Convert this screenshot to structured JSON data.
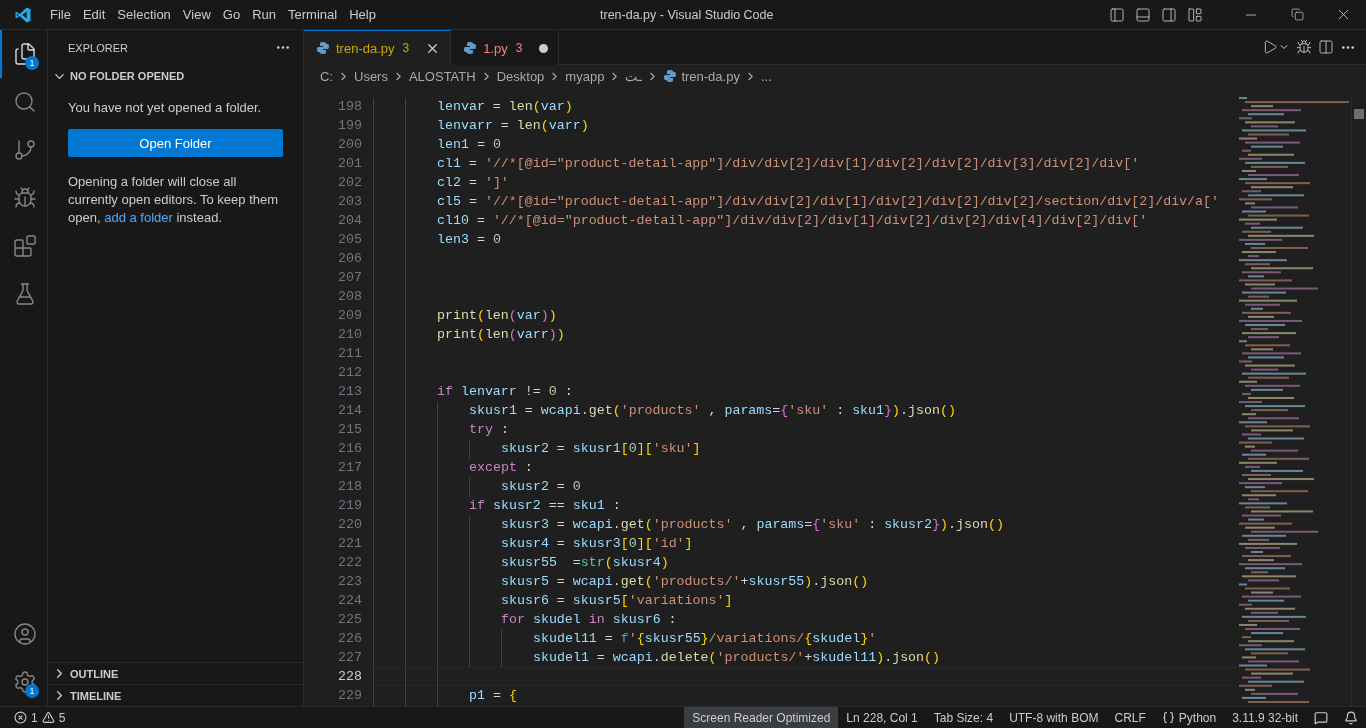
{
  "window": {
    "title": "tren-da.py - Visual Studio Code"
  },
  "menu": [
    "File",
    "Edit",
    "Selection",
    "View",
    "Go",
    "Run",
    "Terminal",
    "Help"
  ],
  "activity_bar": {
    "top": [
      {
        "kind": "files",
        "selected": true,
        "badge": "1"
      },
      {
        "kind": "search",
        "selected": false
      },
      {
        "kind": "source-control",
        "selected": false
      },
      {
        "kind": "debug",
        "selected": false
      },
      {
        "kind": "extensions",
        "selected": false
      },
      {
        "kind": "testing",
        "selected": false
      }
    ],
    "bottom": [
      {
        "kind": "account",
        "selected": false
      },
      {
        "kind": "settings",
        "selected": false,
        "badge": "1"
      }
    ]
  },
  "sidebar": {
    "title": "EXPLORER",
    "section": {
      "title": "NO FOLDER OPENED",
      "expanded": true
    },
    "message": "You have not yet opened a folder.",
    "button": "Open Folder",
    "note": {
      "before": "Opening a folder will close all currently open editors. To keep them open,",
      "link": "add a folder",
      "after": "instead."
    },
    "panels": [
      {
        "title": "OUTLINE",
        "expanded": false
      },
      {
        "title": "TIMELINE",
        "expanded": false
      }
    ]
  },
  "tabs": [
    {
      "label": "tren-da.py",
      "problems": "3",
      "selected": true,
      "dirty": false,
      "color": "#cca700"
    },
    {
      "label": "1.py",
      "problems": "3",
      "selected": false,
      "dirty": true,
      "color": "#f48771"
    }
  ],
  "breadcrumbs": {
    "parts": [
      "C:",
      "Users",
      "ALOSTATH",
      "Desktop",
      "myapp",
      "ـت"
    ],
    "file": "tren-da.py",
    "more": "..."
  },
  "code": [
    {
      "n": "198",
      "current": false,
      "tokens": [
        {
          "kind": "v",
          "text": "lenvar"
        },
        {
          "kind": "o",
          "text": " = "
        },
        {
          "kind": "f",
          "text": "len"
        },
        {
          "kind": "b1",
          "text": "("
        },
        {
          "kind": "v",
          "text": "var"
        },
        {
          "kind": "b1",
          "text": ")"
        }
      ]
    },
    {
      "n": "199",
      "current": false,
      "tokens": [
        {
          "kind": "v",
          "text": "lenvarr"
        },
        {
          "kind": "o",
          "text": " = "
        },
        {
          "kind": "f",
          "text": "len"
        },
        {
          "kind": "b1",
          "text": "("
        },
        {
          "kind": "v",
          "text": "varr"
        },
        {
          "kind": "b1",
          "text": ")"
        }
      ]
    },
    {
      "n": "200",
      "current": false,
      "tokens": [
        {
          "kind": "v",
          "text": "len1"
        },
        {
          "kind": "o",
          "text": " = "
        },
        {
          "kind": "n",
          "text": "0"
        }
      ]
    },
    {
      "n": "201",
      "current": false,
      "tokens": [
        {
          "kind": "v",
          "text": "cl1"
        },
        {
          "kind": "o",
          "text": " = "
        },
        {
          "kind": "s",
          "text": "'//*[@id=\"product-detail-app\"]/div/div[2]/div[1]/div[2]/div[2]/div[3]/div[2]/div['"
        }
      ]
    },
    {
      "n": "202",
      "current": false,
      "tokens": [
        {
          "kind": "v",
          "text": "cl2"
        },
        {
          "kind": "o",
          "text": " = "
        },
        {
          "kind": "s",
          "text": "']'"
        }
      ]
    },
    {
      "n": "203",
      "current": false,
      "tokens": [
        {
          "kind": "v",
          "text": "cl5"
        },
        {
          "kind": "o",
          "text": " = "
        },
        {
          "kind": "s",
          "text": "'//*[@id=\"product-detail-app\"]/div/div[2]/div[1]/div[2]/div[2]/div[2]/section/div[2]/div/a['"
        }
      ]
    },
    {
      "n": "204",
      "current": false,
      "tokens": [
        {
          "kind": "v",
          "text": "cl10"
        },
        {
          "kind": "o",
          "text": " = "
        },
        {
          "kind": "s",
          "text": "'//*[@id=\"product-detail-app\"]/div/div[2]/div[1]/div[2]/div[2]/div[4]/div[2]/div['"
        }
      ]
    },
    {
      "n": "205",
      "current": false,
      "tokens": [
        {
          "kind": "v",
          "text": "len3"
        },
        {
          "kind": "o",
          "text": " = "
        },
        {
          "kind": "n",
          "text": "0"
        }
      ]
    },
    {
      "n": "206",
      "current": false
    },
    {
      "n": "207",
      "current": false
    },
    {
      "n": "208",
      "current": false
    },
    {
      "n": "209",
      "current": false,
      "tokens": [
        {
          "kind": "f",
          "text": "print"
        },
        {
          "kind": "b1",
          "text": "("
        },
        {
          "kind": "f",
          "text": "len"
        },
        {
          "kind": "b2",
          "text": "("
        },
        {
          "kind": "v",
          "text": "var"
        },
        {
          "kind": "b2",
          "text": ")"
        },
        {
          "kind": "b1",
          "text": ")"
        }
      ]
    },
    {
      "n": "210",
      "current": false,
      "tokens": [
        {
          "kind": "f",
          "text": "print"
        },
        {
          "kind": "b1",
          "text": "("
        },
        {
          "kind": "f",
          "text": "len"
        },
        {
          "kind": "b2",
          "text": "("
        },
        {
          "kind": "v",
          "text": "varr"
        },
        {
          "kind": "b2",
          "text": ")"
        },
        {
          "kind": "b1",
          "text": ")"
        }
      ]
    },
    {
      "n": "211",
      "current": false
    },
    {
      "n": "212",
      "current": false
    },
    {
      "n": "213",
      "current": false,
      "tokens": [
        {
          "kind": "k",
          "text": "if"
        },
        {
          "kind": "v",
          "text": " lenvarr"
        },
        {
          "kind": "o",
          "text": " != "
        },
        {
          "kind": "n",
          "text": "0"
        },
        {
          "kind": "o",
          "text": " :"
        }
      ],
      "children": [
        {
          "n": "214",
          "current": false,
          "tokens": [
            {
              "kind": "v",
              "text": "skusr1"
            },
            {
              "kind": "o",
              "text": " = "
            },
            {
              "kind": "v",
              "text": "wcapi"
            },
            {
              "kind": "o",
              "text": "."
            },
            {
              "kind": "f",
              "text": "get"
            },
            {
              "kind": "b1",
              "text": "("
            },
            {
              "kind": "s",
              "text": "'products'"
            },
            {
              "kind": "o",
              "text": " , "
            },
            {
              "kind": "v",
              "text": "params"
            },
            {
              "kind": "o",
              "text": "="
            },
            {
              "kind": "b2",
              "text": "{"
            },
            {
              "kind": "s",
              "text": "'sku'"
            },
            {
              "kind": "o",
              "text": " : "
            },
            {
              "kind": "v",
              "text": "sku1"
            },
            {
              "kind": "b2",
              "text": "}"
            },
            {
              "kind": "b1",
              "text": ")"
            },
            {
              "kind": "o",
              "text": "."
            },
            {
              "kind": "f",
              "text": "json"
            },
            {
              "kind": "b1",
              "text": "()"
            }
          ]
        },
        {
          "n": "215",
          "current": false,
          "tokens": [
            {
              "kind": "k",
              "text": "try"
            },
            {
              "kind": "o",
              "text": " :"
            }
          ],
          "children": [
            {
              "n": "216",
              "current": false,
              "tokens": [
                {
                  "kind": "v",
                  "text": "skusr2"
                },
                {
                  "kind": "o",
                  "text": " = "
                },
                {
                  "kind": "v",
                  "text": "skusr1"
                },
                {
                  "kind": "b1",
                  "text": "["
                },
                {
                  "kind": "n",
                  "text": "0"
                },
                {
                  "kind": "b1",
                  "text": "]["
                },
                {
                  "kind": "s",
                  "text": "'sku'"
                },
                {
                  "kind": "b1",
                  "text": "]"
                }
              ]
            }
          ]
        },
        {
          "n": "217",
          "current": false,
          "tokens": [
            {
              "kind": "k",
              "text": "except"
            },
            {
              "kind": "o",
              "text": " :"
            }
          ],
          "children": [
            {
              "n": "218",
              "current": false,
              "tokens": [
                {
                  "kind": "v",
                  "text": "skusr2"
                },
                {
                  "kind": "o",
                  "text": " = "
                },
                {
                  "kind": "n",
                  "text": "0"
                }
              ]
            }
          ]
        },
        {
          "n": "219",
          "current": false,
          "tokens": [
            {
              "kind": "k",
              "text": "if"
            },
            {
              "kind": "v",
              "text": " skusr2"
            },
            {
              "kind": "o",
              "text": " == "
            },
            {
              "kind": "v",
              "text": "sku1"
            },
            {
              "kind": "o",
              "text": " :"
            }
          ],
          "children": [
            {
              "n": "220",
              "current": false,
              "tokens": [
                {
                  "kind": "v",
                  "text": "skusr3"
                },
                {
                  "kind": "o",
                  "text": " = "
                },
                {
                  "kind": "v",
                  "text": "wcapi"
                },
                {
                  "kind": "o",
                  "text": "."
                },
                {
                  "kind": "f",
                  "text": "get"
                },
                {
                  "kind": "b1",
                  "text": "("
                },
                {
                  "kind": "s",
                  "text": "'products'"
                },
                {
                  "kind": "o",
                  "text": " , "
                },
                {
                  "kind": "v",
                  "text": "params"
                },
                {
                  "kind": "o",
                  "text": "="
                },
                {
                  "kind": "b2",
                  "text": "{"
                },
                {
                  "kind": "s",
                  "text": "'sku'"
                },
                {
                  "kind": "o",
                  "text": " : "
                },
                {
                  "kind": "v",
                  "text": "skusr2"
                },
                {
                  "kind": "b2",
                  "text": "}"
                },
                {
                  "kind": "b1",
                  "text": ")"
                },
                {
                  "kind": "o",
                  "text": "."
                },
                {
                  "kind": "f",
                  "text": "json"
                },
                {
                  "kind": "b1",
                  "text": "()"
                }
              ]
            },
            {
              "n": "221",
              "current": false,
              "tokens": [
                {
                  "kind": "v",
                  "text": "skusr4"
                },
                {
                  "kind": "o",
                  "text": " = "
                },
                {
                  "kind": "v",
                  "text": "skusr3"
                },
                {
                  "kind": "b1",
                  "text": "["
                },
                {
                  "kind": "n",
                  "text": "0"
                },
                {
                  "kind": "b1",
                  "text": "]["
                },
                {
                  "kind": "s",
                  "text": "'id'"
                },
                {
                  "kind": "b1",
                  "text": "]"
                }
              ]
            },
            {
              "n": "222",
              "current": false,
              "tokens": [
                {
                  "kind": "v",
                  "text": "skusr55"
                },
                {
                  "kind": "o",
                  "text": "  ="
                },
                {
                  "kind": "t",
                  "text": "str"
                },
                {
                  "kind": "b1",
                  "text": "("
                },
                {
                  "kind": "v",
                  "text": "skusr4"
                },
                {
                  "kind": "b1",
                  "text": ")"
                }
              ]
            },
            {
              "n": "223",
              "current": false,
              "tokens": [
                {
                  "kind": "v",
                  "text": "skusr5"
                },
                {
                  "kind": "o",
                  "text": " = "
                },
                {
                  "kind": "v",
                  "text": "wcapi"
                },
                {
                  "kind": "o",
                  "text": "."
                },
                {
                  "kind": "f",
                  "text": "get"
                },
                {
                  "kind": "b1",
                  "text": "("
                },
                {
                  "kind": "s",
                  "text": "'products/'"
                },
                {
                  "kind": "o",
                  "text": "+"
                },
                {
                  "kind": "v",
                  "text": "skusr55"
                },
                {
                  "kind": "b1",
                  "text": ")"
                },
                {
                  "kind": "o",
                  "text": "."
                },
                {
                  "kind": "f",
                  "text": "json"
                },
                {
                  "kind": "b1",
                  "text": "()"
                }
              ]
            },
            {
              "n": "224",
              "current": false,
              "tokens": [
                {
                  "kind": "v",
                  "text": "skusr6"
                },
                {
                  "kind": "o",
                  "text": " = "
                },
                {
                  "kind": "v",
                  "text": "skusr5"
                },
                {
                  "kind": "b1",
                  "text": "["
                },
                {
                  "kind": "s",
                  "text": "'variations'"
                },
                {
                  "kind": "b1",
                  "text": "]"
                }
              ]
            },
            {
              "n": "225",
              "current": false,
              "tokens": [
                {
                  "kind": "k",
                  "text": "for"
                },
                {
                  "kind": "v",
                  "text": " skudel"
                },
                {
                  "kind": "k",
                  "text": " in"
                },
                {
                  "kind": "v",
                  "text": " skusr6"
                },
                {
                  "kind": "o",
                  "text": " :"
                }
              ],
              "children": [
                {
                  "n": "226",
                  "current": false,
                  "tokens": [
                    {
                      "kind": "v",
                      "text": "skudel11"
                    },
                    {
                      "kind": "o",
                      "text": " = "
                    },
                    {
                      "kind": "sf",
                      "text": "f"
                    },
                    {
                      "kind": "s",
                      "text": "'"
                    },
                    {
                      "kind": "b1",
                      "text": "{"
                    },
                    {
                      "kind": "v",
                      "text": "skusr55"
                    },
                    {
                      "kind": "b1",
                      "text": "}"
                    },
                    {
                      "kind": "s",
                      "text": "/variations/"
                    },
                    {
                      "kind": "b1",
                      "text": "{"
                    },
                    {
                      "kind": "v",
                      "text": "skudel"
                    },
                    {
                      "kind": "b1",
                      "text": "}"
                    },
                    {
                      "kind": "s",
                      "text": "'"
                    }
                  ]
                },
                {
                  "n": "227",
                  "current": false,
                  "tokens": [
                    {
                      "kind": "v",
                      "text": "skudel1"
                    },
                    {
                      "kind": "o",
                      "text": " = "
                    },
                    {
                      "kind": "v",
                      "text": "wcapi"
                    },
                    {
                      "kind": "o",
                      "text": "."
                    },
                    {
                      "kind": "f",
                      "text": "delete"
                    },
                    {
                      "kind": "b1",
                      "text": "("
                    },
                    {
                      "kind": "s",
                      "text": "'products/'"
                    },
                    {
                      "kind": "o",
                      "text": "+"
                    },
                    {
                      "kind": "v",
                      "text": "skudel11"
                    },
                    {
                      "kind": "b1",
                      "text": ")"
                    },
                    {
                      "kind": "o",
                      "text": "."
                    },
                    {
                      "kind": "f",
                      "text": "json"
                    },
                    {
                      "kind": "b1",
                      "text": "()"
                    }
                  ]
                }
              ]
            }
          ]
        },
        {
          "n": "228",
          "current": true
        },
        {
          "n": "229",
          "current": false,
          "tokens": [
            {
              "kind": "v",
              "text": "p1"
            },
            {
              "kind": "o",
              "text": " = "
            },
            {
              "kind": "b1",
              "text": "{"
            }
          ]
        }
      ]
    }
  ],
  "status_bar": {
    "errors": "1",
    "warnings": "5",
    "items": [
      {
        "label": "Screen Reader Optimized",
        "selected": true
      },
      {
        "label": "Ln 228, Col 1",
        "selected": false
      },
      {
        "label": "Tab Size: 4",
        "selected": false
      },
      {
        "label": "UTF-8 with BOM",
        "selected": false
      },
      {
        "label": "CRLF",
        "selected": false
      },
      {
        "label": "Python",
        "selected": false,
        "kind": "language"
      },
      {
        "label": "3.11.9 32-bit",
        "selected": false
      }
    ]
  }
}
